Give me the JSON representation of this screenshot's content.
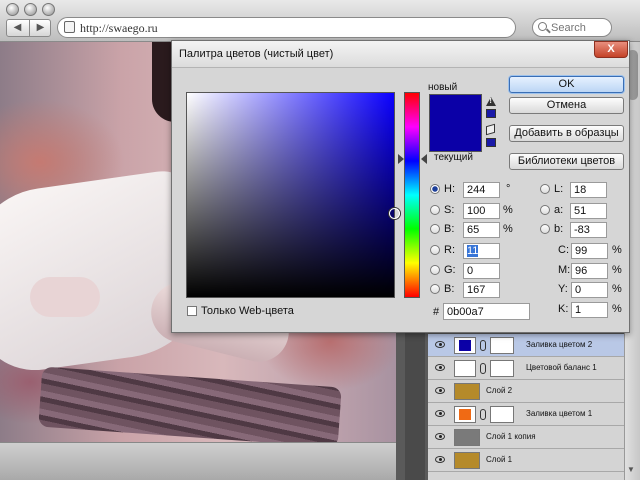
{
  "browser": {
    "url": "http://swaego.ru",
    "search_placeholder": "Search",
    "back": "◀",
    "forward": "▶"
  },
  "dialog": {
    "title": "Палитра цветов (чистый цвет)",
    "close": "X",
    "label_new": "новый",
    "label_current": "текущий",
    "new_color": "#0b00a7",
    "current_color": "#0b00a7",
    "buttons": {
      "ok": "OK",
      "cancel": "Отмена",
      "add_swatch": "Добавить в образцы",
      "libraries": "Библиотеки цветов"
    },
    "hsb": [
      {
        "label": "H:",
        "value": "244",
        "unit": "°",
        "checked": true
      },
      {
        "label": "S:",
        "value": "100",
        "unit": "%",
        "checked": false
      },
      {
        "label": "B:",
        "value": "65",
        "unit": "%",
        "checked": false
      }
    ],
    "rgb": [
      {
        "label": "R:",
        "value": "11",
        "checked": false
      },
      {
        "label": "G:",
        "value": "0",
        "checked": false
      },
      {
        "label": "B:",
        "value": "167",
        "checked": false
      }
    ],
    "lab": [
      {
        "label": "L:",
        "value": "18"
      },
      {
        "label": "a:",
        "value": "51"
      },
      {
        "label": "b:",
        "value": "-83"
      }
    ],
    "cmyk": [
      {
        "label": "C:",
        "value": "99",
        "unit": "%"
      },
      {
        "label": "M:",
        "value": "96",
        "unit": "%"
      },
      {
        "label": "Y:",
        "value": "0",
        "unit": "%"
      },
      {
        "label": "K:",
        "value": "1",
        "unit": "%"
      }
    ],
    "web_only_label": "Только Web-цвета",
    "hex_label": "#",
    "hex_value": "0b00a7"
  },
  "layers": [
    {
      "name": "Заливка цветом 2",
      "selected": true,
      "thumb_color": "#0b00a7",
      "has_mask": true
    },
    {
      "name": "Цветовой баланс 1",
      "selected": false,
      "thumb_color": "#ffffff",
      "has_mask": true
    },
    {
      "name": "Слой 2",
      "selected": false,
      "thumb_color": "#b58a2a",
      "has_mask": false
    },
    {
      "name": "Заливка цветом 1",
      "selected": false,
      "thumb_color": "#f06a14",
      "has_mask": true
    },
    {
      "name": "Слой 1 копия",
      "selected": false,
      "thumb_color": "#7a7a7a",
      "has_mask": false
    },
    {
      "name": "Слой 1",
      "selected": false,
      "thumb_color": "#b58a2a",
      "has_mask": false
    }
  ]
}
